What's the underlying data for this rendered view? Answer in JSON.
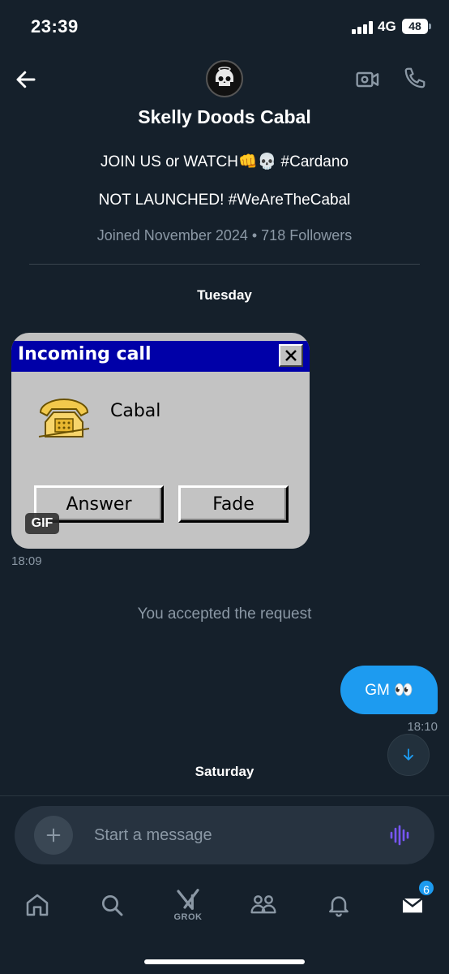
{
  "status_bar": {
    "time": "23:39",
    "network": "4G",
    "battery": "48"
  },
  "header": {
    "name": "Skelly Doods Cabal",
    "bio_line1": "JOIN US or WATCH👊💀 #Cardano",
    "bio_line2": "NOT LAUNCHED! #WeAreTheCabal",
    "meta": "Joined November 2024 • 718 Followers"
  },
  "conversation": {
    "day1": "Tuesday",
    "gif": {
      "window_title": "Incoming call",
      "caller": "Cabal",
      "answer_label": "Answer",
      "fade_label": "Fade",
      "badge": "GIF",
      "time": "18:09"
    },
    "system_message": "You accepted the request",
    "my_message": {
      "text": "GM 👀",
      "time": "18:10"
    },
    "day2": "Saturday"
  },
  "composer": {
    "placeholder": "Start a message"
  },
  "nav": {
    "items": [
      "home-icon",
      "search-icon",
      "grok-icon",
      "communities-icon",
      "notifications-icon",
      "messages-icon"
    ],
    "grok_label": "GROK",
    "messages_badge": "6"
  },
  "colors": {
    "background": "#15202b",
    "accent": "#1d9bf0",
    "muted": "#8b98a5",
    "voice": "#7856ff"
  }
}
